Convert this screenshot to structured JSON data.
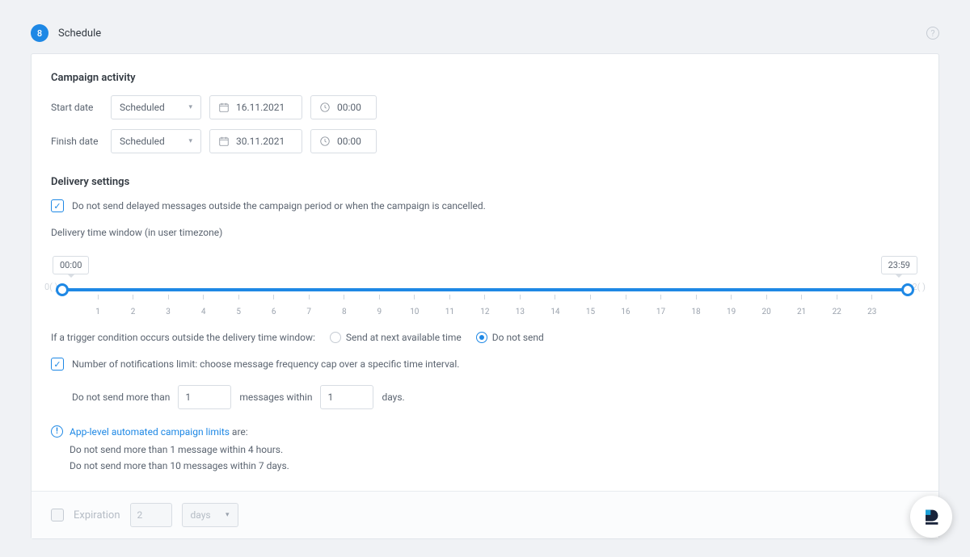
{
  "header": {
    "step_number": "8",
    "title": "Schedule"
  },
  "activity": {
    "title": "Campaign activity",
    "start_label": "Start date",
    "finish_label": "Finish date",
    "start_mode": "Scheduled",
    "finish_mode": "Scheduled",
    "start_date": "16.11.2021",
    "finish_date": "30.11.2021",
    "start_time": "00:00",
    "finish_time": "00:00"
  },
  "delivery": {
    "title": "Delivery settings",
    "no_delayed_label": "Do not send delayed messages outside the campaign period or when the campaign is cancelled.",
    "window_label": "Delivery time window (in user timezone)",
    "window_from": "00:00",
    "window_to": "23:59",
    "outside_label": "If a trigger condition occurs outside the delivery time window:",
    "opt_send_next": "Send at next available time",
    "opt_do_not_send": "Do not send",
    "freq_limit_label": "Number of notifications limit: choose message frequency cap over a specific time interval.",
    "freq_sentence_a": "Do not send more than",
    "freq_messages": "1",
    "freq_sentence_b": "messages within",
    "freq_days": "1",
    "freq_sentence_c": "days.",
    "ticks": [
      "1",
      "2",
      "3",
      "4",
      "5",
      "6",
      "7",
      "8",
      "9",
      "10",
      "11",
      "12",
      "13",
      "14",
      "15",
      "16",
      "17",
      "18",
      "19",
      "20",
      "21",
      "22",
      "23"
    ]
  },
  "info": {
    "link_text": "App-level automated campaign limits",
    "suffix": " are:",
    "line1": "Do not send more than 1 message within 4 hours.",
    "line2": "Do not send more than 10 messages within 7 days."
  },
  "footer": {
    "expiration_label": "Expiration",
    "expiration_value": "2",
    "expiration_unit": "days"
  }
}
